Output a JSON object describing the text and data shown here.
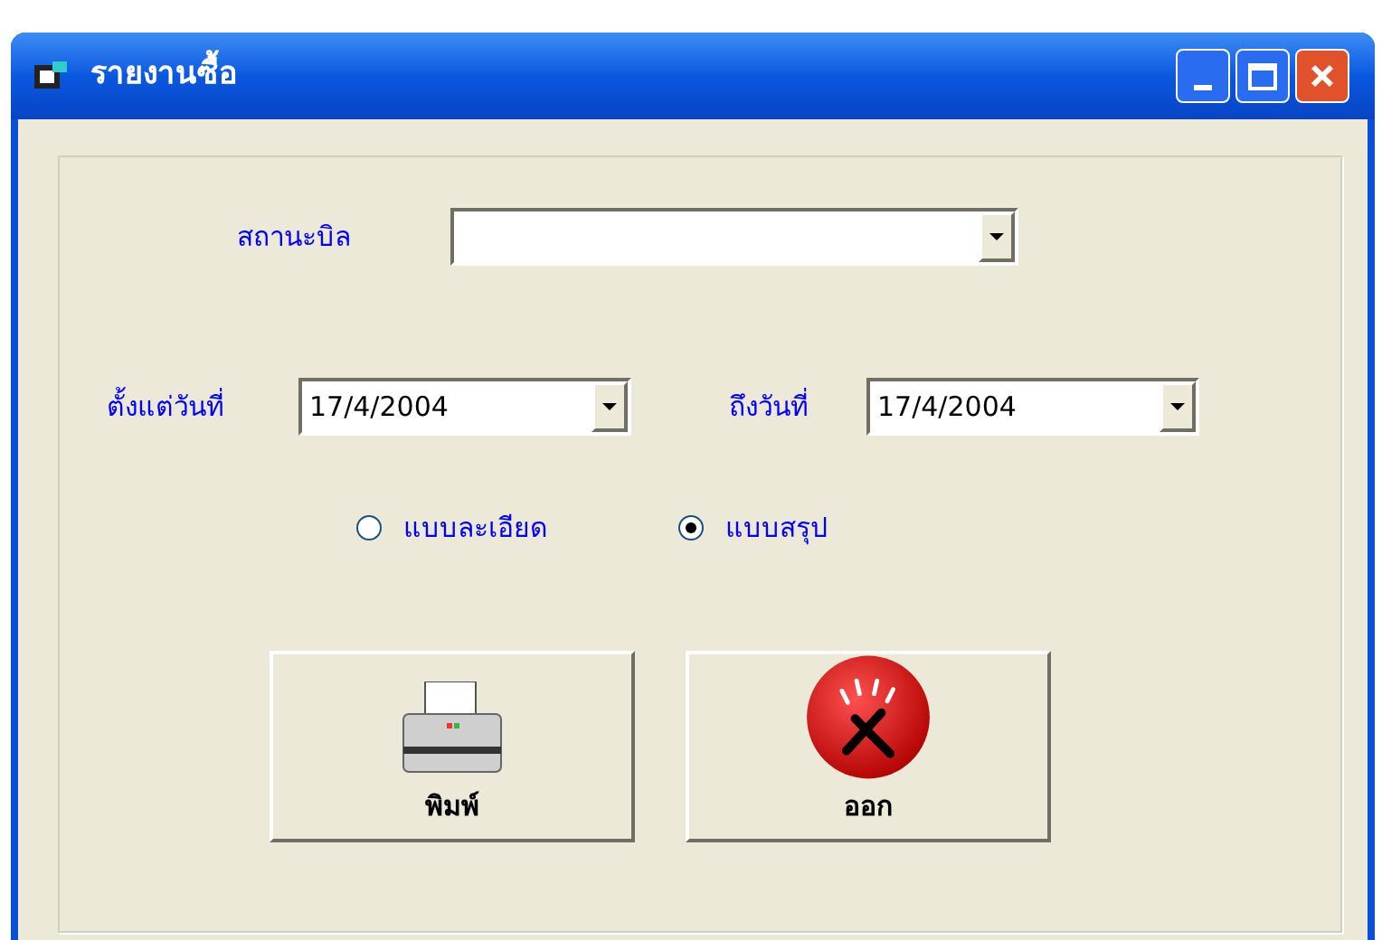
{
  "window": {
    "title": "รายงานซื้อ"
  },
  "bill_status": {
    "label": "สถานะบิล"
  },
  "date_from": {
    "label": "ตั้งแต่วันที่",
    "value": "17/4/2004"
  },
  "date_to": {
    "label": "ถึงวันที่",
    "value": "17/4/2004"
  },
  "report_types": [
    {
      "label": "แบบละเอียด",
      "selected": false
    },
    {
      "label": "แบบสรุป",
      "selected": true
    }
  ],
  "buttons": [
    {
      "kind": "print",
      "label": "พิมพ์"
    },
    {
      "kind": "exit",
      "label": "ออก"
    }
  ]
}
